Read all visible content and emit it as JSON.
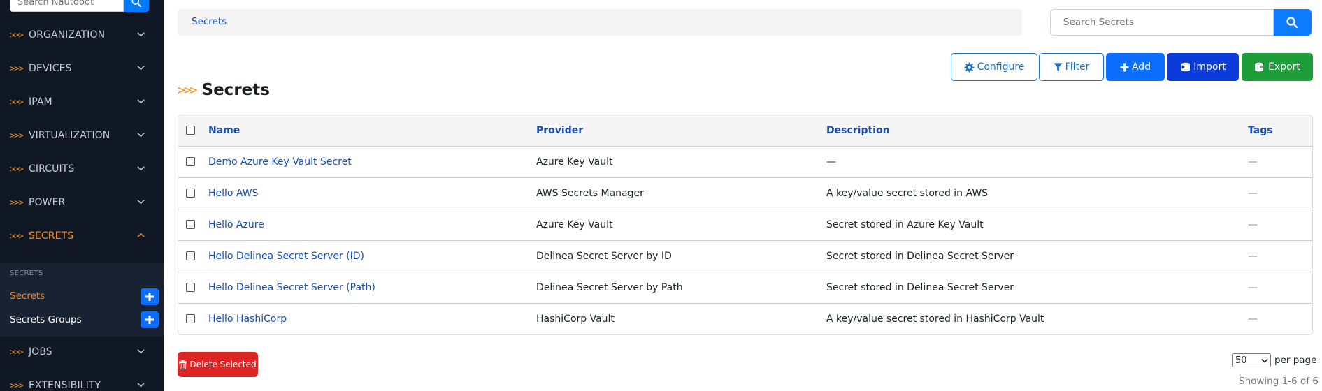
{
  "sidebar": {
    "search_placeholder": "Search Nautobot",
    "nav": [
      {
        "label": "ORGANIZATION",
        "active": false
      },
      {
        "label": "DEVICES",
        "active": false
      },
      {
        "label": "IPAM",
        "active": false
      },
      {
        "label": "VIRTUALIZATION",
        "active": false
      },
      {
        "label": "CIRCUITS",
        "active": false
      },
      {
        "label": "POWER",
        "active": false
      },
      {
        "label": "SECRETS",
        "active": true
      },
      {
        "label": "JOBS",
        "active": false
      },
      {
        "label": "EXTENSIBILITY",
        "active": false
      }
    ],
    "chevron_glyph": ">>>",
    "sub_section_label": "SECRETS",
    "sub_items": [
      {
        "label": "Secrets",
        "active": true
      },
      {
        "label": "Secrets Groups",
        "active": false
      }
    ]
  },
  "breadcrumb": {
    "label": "Secrets"
  },
  "search": {
    "placeholder": "Search Secrets"
  },
  "toolbar": {
    "configure_label": "Configure",
    "filter_label": "Filter",
    "add_label": "Add",
    "import_label": "Import",
    "export_label": "Export"
  },
  "page": {
    "chevron": ">>>",
    "title": "Secrets"
  },
  "table": {
    "columns": [
      "Name",
      "Provider",
      "Description",
      "Tags"
    ],
    "rows": [
      {
        "name": "Demo Azure Key Vault Secret",
        "provider": "Azure Key Vault",
        "description": "—",
        "tags": "—"
      },
      {
        "name": "Hello AWS",
        "provider": "AWS Secrets Manager",
        "description": "A key/value secret stored in AWS",
        "tags": "—"
      },
      {
        "name": "Hello Azure",
        "provider": "Azure Key Vault",
        "description": "Secret stored in Azure Key Vault",
        "tags": "—"
      },
      {
        "name": "Hello Delinea Secret Server (ID)",
        "provider": "Delinea Secret Server by ID",
        "description": "Secret stored in Delinea Secret Server",
        "tags": "—"
      },
      {
        "name": "Hello Delinea Secret Server (Path)",
        "provider": "Delinea Secret Server by Path",
        "description": "Secret stored in Delinea Secret Server",
        "tags": "—"
      },
      {
        "name": "Hello HashiCorp",
        "provider": "HashiCorp Vault",
        "description": "A key/value secret stored in HashiCorp Vault",
        "tags": "—"
      }
    ]
  },
  "footer": {
    "delete_label": "Delete Selected",
    "per_page_value": "50",
    "per_page_label": "per page",
    "showing": "Showing 1-6 of 6"
  },
  "colors": {
    "sidebar_bg": "#101826",
    "accent_orange": "#f28c28",
    "primary": "#0d6efd",
    "import": "#0b3bd9",
    "export": "#1f9d3b",
    "danger": "#dc2626",
    "link": "#1a4fb8"
  },
  "icons": [
    "search-icon",
    "chevron-down-icon",
    "chevron-up-icon",
    "plus-icon",
    "gear-icon",
    "filter-icon",
    "database-import-icon",
    "database-export-icon",
    "trash-icon"
  ]
}
